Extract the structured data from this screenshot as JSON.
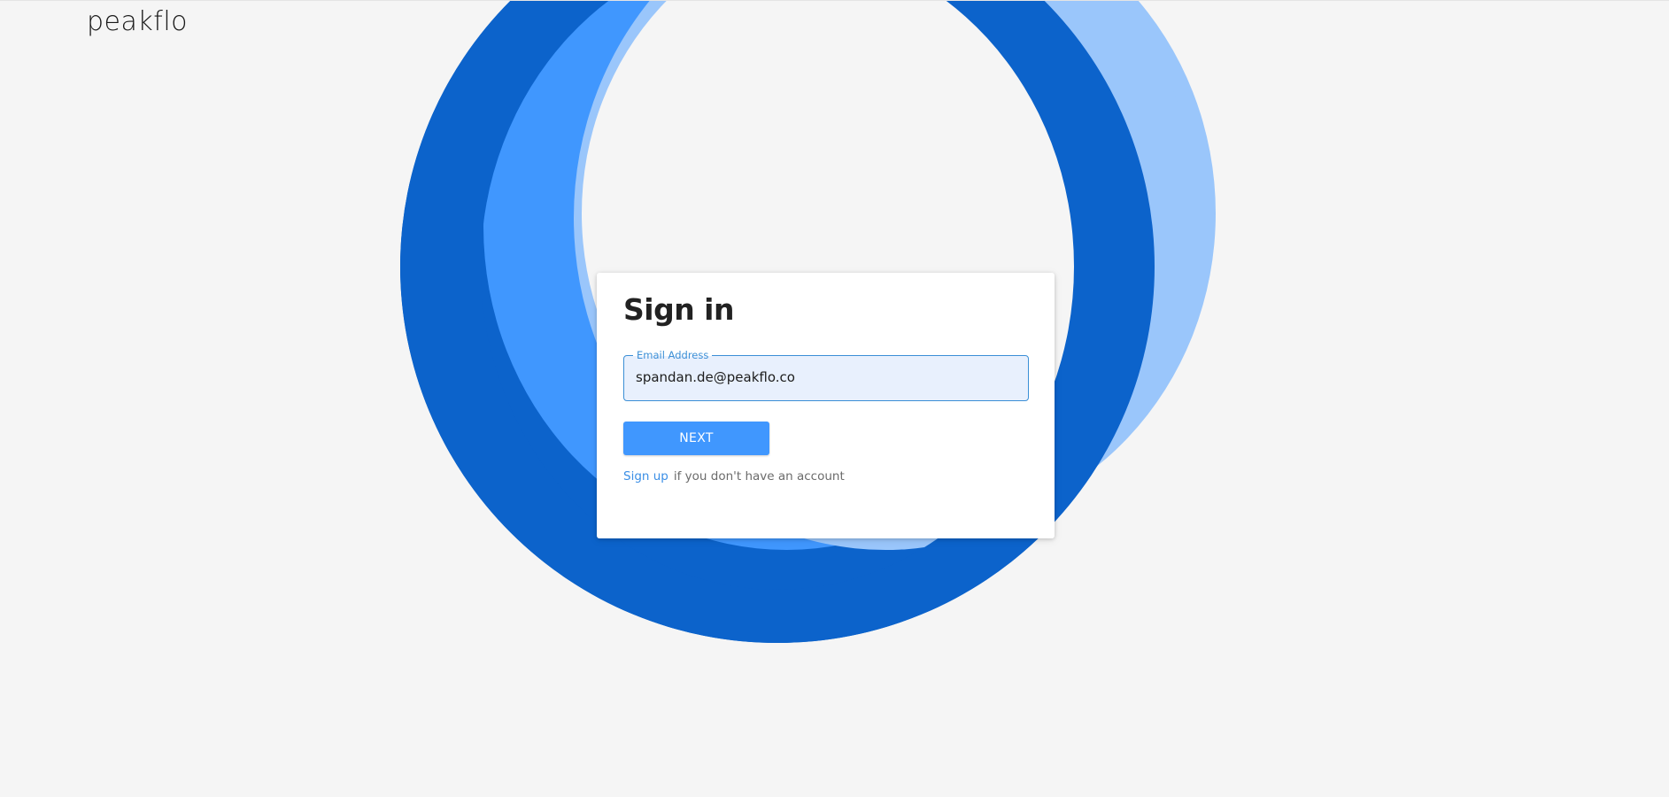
{
  "brand": {
    "logo_text": "peakflo"
  },
  "colors": {
    "ring_dark": "#0c63cb",
    "ring_mid": "#4097fe",
    "ring_light": "#9ac6fb",
    "accent": "#4097fe",
    "background": "#f5f5f5"
  },
  "signin": {
    "title": "Sign in",
    "email_label": "Email Address",
    "email_value": "spandan.de@peakflo.co",
    "next_label": "NEXT",
    "signup_link": "Sign up",
    "signup_text": "if you don't have an account"
  }
}
